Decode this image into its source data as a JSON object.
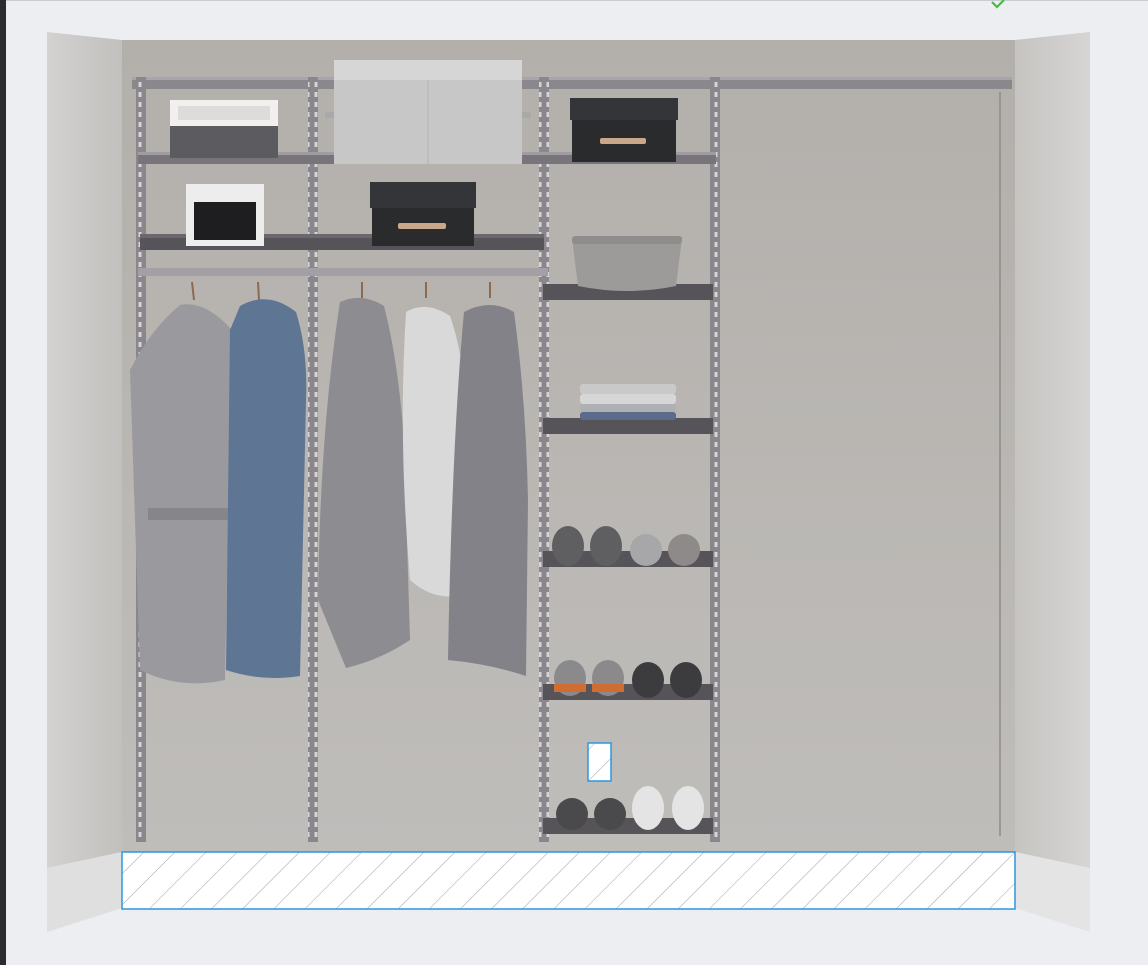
{
  "colors": {
    "background": "#eceef1",
    "wall": "#b9b6b2",
    "side_wall": "#c8c6c3",
    "floor": "#e2e2e3",
    "upright": "#7f7c82",
    "shelf": "#565458",
    "rail": "#8d8a8f",
    "selection": "#2b97e0",
    "confirm_green": "#4cb848"
  },
  "icons": {
    "confirm": "check-icon"
  },
  "closet": {
    "sections": [
      {
        "name": "hanging-section-left",
        "items": [
          "trench-coat",
          "quilted-parka"
        ]
      },
      {
        "name": "hanging-section-middle",
        "items": [
          "grey-coat",
          "white-jacket",
          "grey-long-coat"
        ]
      },
      {
        "name": "shelving-section-right",
        "items": [
          "fabric-basket",
          "folded-shirts",
          "sneakers-row-1",
          "sneakers-row-2",
          "sneakers-row-3"
        ]
      }
    ],
    "top_storage": [
      "wicker-basket",
      "large-storage-box",
      "black-lidded-box",
      "white-open-bin",
      "black-lidded-box-2"
    ],
    "selections": [
      "floor-zone-selection",
      "hook-placeholder-selection"
    ]
  }
}
